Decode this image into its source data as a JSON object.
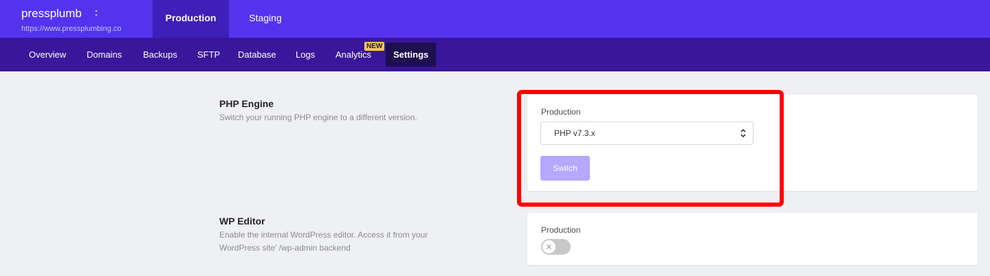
{
  "site": {
    "name": "pressplumb",
    "url": "https://www.pressplumbing.co"
  },
  "env_tabs": [
    {
      "label": "Production",
      "active": true
    },
    {
      "label": "Staging",
      "active": false
    }
  ],
  "subnav": {
    "items": [
      {
        "label": "Overview"
      },
      {
        "label": "Domains"
      },
      {
        "label": "Backups"
      },
      {
        "label": "SFTP"
      },
      {
        "label": "Database"
      },
      {
        "label": "Logs"
      },
      {
        "label": "Analytics"
      },
      {
        "label": "Settings"
      }
    ],
    "analytics_badge": "NEW",
    "active": "Settings"
  },
  "php_engine": {
    "title": "PHP Engine",
    "description": "Switch your running PHP engine to a different version.",
    "env_label": "Production",
    "selected_version": "PHP v7.3.x",
    "switch_label": "Switch"
  },
  "wp_editor": {
    "title": "WP Editor",
    "description": "Enable the internal WordPress editor. Access it from your WordPress site' /wp-admin backend",
    "env_label": "Production",
    "enabled": false
  },
  "colors": {
    "primary": "#5333ed",
    "subnav": "#3a169a",
    "active_tab": "#1d0f50",
    "button_disabled": "#b6a7ff",
    "highlight": "#ff0000",
    "badge": "#f5c851"
  },
  "icons": {
    "site_menu": "vertical-dots-icon",
    "select_arrows": "up-down-chevron-icon",
    "toggle_off": "x-icon"
  }
}
